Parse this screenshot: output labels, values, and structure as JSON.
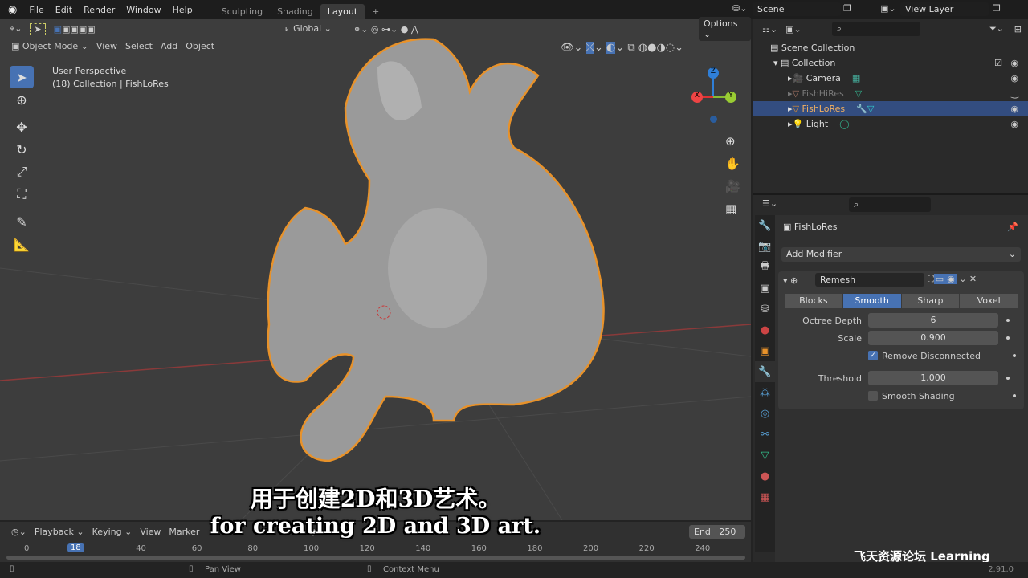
{
  "menu": [
    "File",
    "Edit",
    "Render",
    "Window",
    "Help"
  ],
  "workspaces": [
    {
      "label": "Sculpting"
    },
    {
      "label": "Shading"
    },
    {
      "label": "Layout",
      "active": true
    }
  ],
  "scene": "Scene",
  "view_layer": "View Layer",
  "header": {
    "transform": "Global",
    "options": "Options",
    "mode": "Object Mode",
    "menus": [
      "View",
      "Select",
      "Add",
      "Object"
    ]
  },
  "viewport": {
    "perspective": "User Perspective",
    "collection_info": "(18) Collection | FishLoRes",
    "axes": {
      "x": "X",
      "y": "Y",
      "z": "Z"
    }
  },
  "outliner": {
    "root": "Scene Collection",
    "collection": "Collection",
    "items": [
      {
        "name": "Camera"
      },
      {
        "name": "FishHiRes",
        "disabled": true
      },
      {
        "name": "FishLoRes",
        "selected": true
      },
      {
        "name": "Light"
      }
    ]
  },
  "properties": {
    "object": "FishLoRes",
    "add_modifier": "Add Modifier",
    "modifier": "Remesh",
    "modes": [
      "Blocks",
      "Smooth",
      "Sharp",
      "Voxel"
    ],
    "active_mode": "Smooth",
    "fields": {
      "octree_label": "Octree Depth",
      "octree": "6",
      "scale_label": "Scale",
      "scale": "0.900",
      "remove_disconnected": "Remove Disconnected",
      "threshold_label": "Threshold",
      "threshold": "1.000",
      "smooth_shading": "Smooth Shading"
    },
    "remove_disconnected_checked": true,
    "smooth_shading_checked": false
  },
  "timeline": {
    "menus": [
      "Playback",
      "Keying",
      "View",
      "Marker"
    ],
    "end_label": "End",
    "end": "250",
    "current_frame": "18",
    "ticks": [
      "0",
      "40",
      "60",
      "80",
      "100",
      "120",
      "140",
      "160",
      "180",
      "200",
      "220",
      "240"
    ]
  },
  "status": {
    "pan": "Pan View",
    "context": "Context Menu",
    "version": "2.91.0"
  },
  "subtitles": {
    "zh": "用于创建2D和3D艺术。",
    "en": "for creating 2D and 3D art."
  },
  "watermark": "飞天资源论坛 Learning",
  "colors": {
    "accent": "#4772b3",
    "selection_outline": "#e8922a"
  }
}
